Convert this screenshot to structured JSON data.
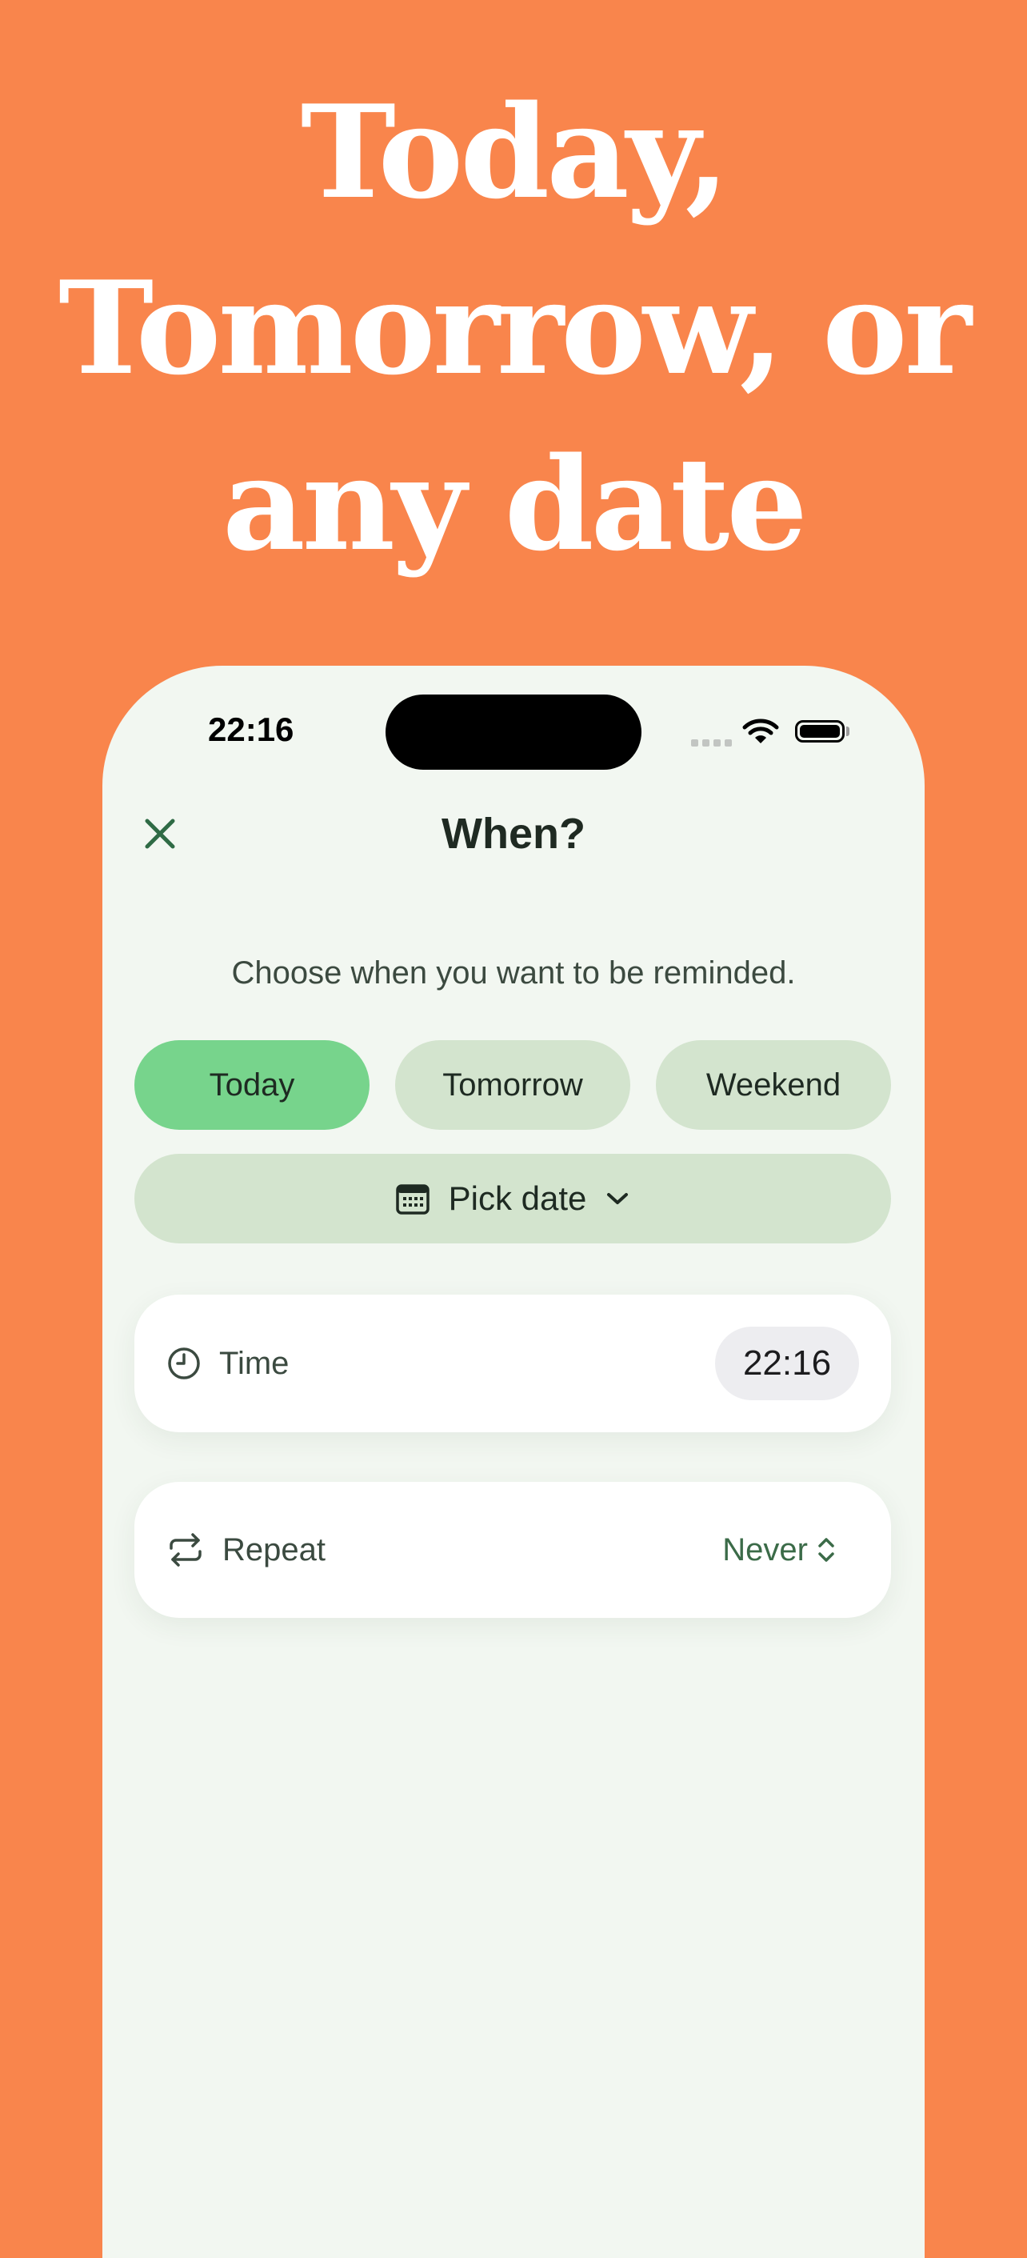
{
  "headline": {
    "line1": "Today,",
    "line2": "Tomorrow, or",
    "line3": "any date"
  },
  "status_bar": {
    "time": "22:16"
  },
  "nav": {
    "title": "When?"
  },
  "subtitle": "Choose when you want to be reminded.",
  "quick_options": [
    {
      "label": "Today",
      "selected": true
    },
    {
      "label": "Tomorrow",
      "selected": false
    },
    {
      "label": "Weekend",
      "selected": false
    }
  ],
  "pick_date": {
    "label": "Pick date"
  },
  "time_row": {
    "label": "Time",
    "value": "22:16"
  },
  "repeat_row": {
    "label": "Repeat",
    "value": "Never"
  },
  "colors": {
    "background": "#F9854C",
    "screen": "#F2F7F1",
    "chip_selected": "#77D48C",
    "chip": "#D3E4CE",
    "accent_green": "#2F6B45"
  },
  "icons": {
    "close": "close-icon",
    "calendar": "calendar-icon",
    "chevron": "chevron-down-icon",
    "clock": "clock-icon",
    "repeat": "repeat-icon",
    "updown": "chevron-up-down-icon"
  }
}
